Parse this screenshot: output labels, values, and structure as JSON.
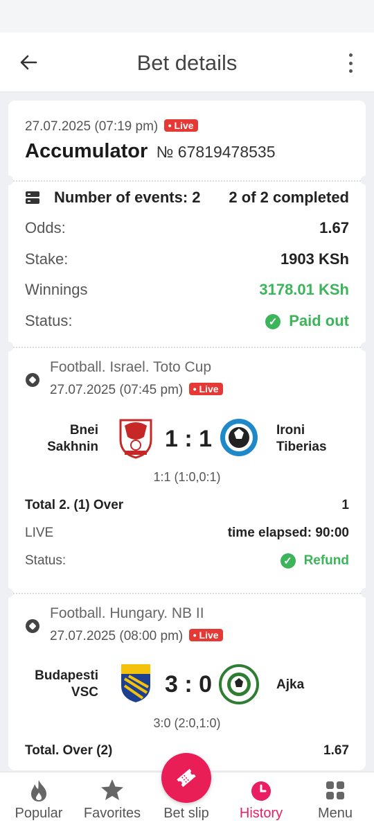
{
  "header": {
    "title": "Bet details"
  },
  "summary": {
    "date": "27.07.2025 (07:19 pm)",
    "live_label": "Live",
    "bet_type": "Accumulator",
    "bet_number": "№ 67819478535",
    "events_label": "Number of events: 2",
    "completed_label": "2 of 2 completed",
    "rows": [
      {
        "label": "Odds:",
        "value": "1.67"
      },
      {
        "label": "Stake:",
        "value": "1903 KSh"
      },
      {
        "label": "Winnings",
        "value": "3178.01 KSh"
      },
      {
        "label": "Status:",
        "value": "Paid out"
      }
    ]
  },
  "events": [
    {
      "league": "Football. Israel. Toto Cup",
      "date": "27.07.2025 (07:45 pm)",
      "live_label": "Live",
      "home": "Bnei\nSakhnin",
      "away": "Ironi\nTiberias",
      "score": "1 : 1",
      "detail": "1:1 (1:0,0:1)",
      "market": "Total 2. (1) Over",
      "odds": "1",
      "live_text": "LIVE",
      "elapsed": "time elapsed: 90:00",
      "status_label": "Status:",
      "status": "Refund"
    },
    {
      "league": "Football. Hungary. NB II",
      "date": "27.07.2025 (08:00 pm)",
      "live_label": "Live",
      "home": "Budapesti\nVSC",
      "away": "Ajka",
      "score": "3 : 0",
      "detail": "3:0 (2:0,1:0)",
      "market": "Total. Over (2)",
      "odds": "1.67"
    }
  ],
  "tabbar": {
    "tabs": [
      {
        "label": "Popular"
      },
      {
        "label": "Favorites"
      },
      {
        "label": "Bet slip"
      },
      {
        "label": "History"
      },
      {
        "label": "Menu"
      }
    ]
  },
  "colors": {
    "accent": "#e91e57",
    "success": "#3cb45a",
    "live": "#e53935"
  }
}
